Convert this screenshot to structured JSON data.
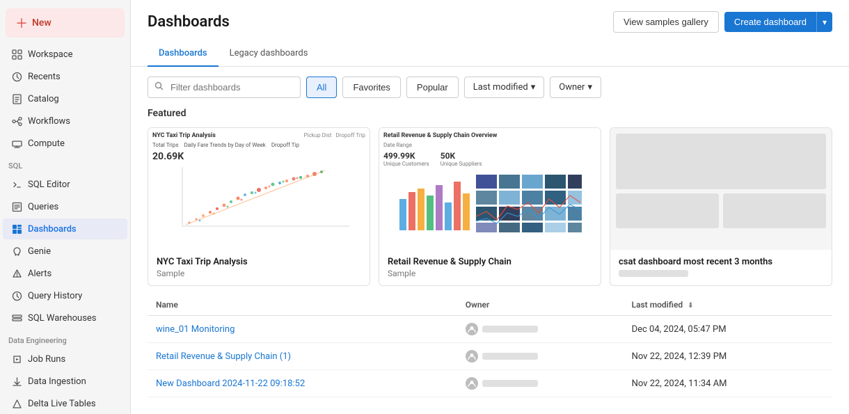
{
  "sidebar": {
    "new_label": "New",
    "items": [
      {
        "id": "workspace",
        "label": "Workspace",
        "icon": "grid"
      },
      {
        "id": "recents",
        "label": "Recents",
        "icon": "clock"
      },
      {
        "id": "catalog",
        "label": "Catalog",
        "icon": "book"
      },
      {
        "id": "workflows",
        "label": "Workflows",
        "icon": "flow"
      },
      {
        "id": "compute",
        "label": "Compute",
        "icon": "server"
      }
    ],
    "sql_section": "SQL",
    "sql_items": [
      {
        "id": "sql-editor",
        "label": "SQL Editor",
        "icon": "code"
      },
      {
        "id": "queries",
        "label": "Queries",
        "icon": "list"
      },
      {
        "id": "dashboards",
        "label": "Dashboards",
        "icon": "dashboard",
        "active": true
      },
      {
        "id": "genie",
        "label": "Genie",
        "icon": "genie"
      },
      {
        "id": "alerts",
        "label": "Alerts",
        "icon": "bell"
      },
      {
        "id": "query-history",
        "label": "Query History",
        "icon": "history"
      },
      {
        "id": "sql-warehouses",
        "label": "SQL Warehouses",
        "icon": "warehouse"
      }
    ],
    "data_engineering_section": "Data Engineering",
    "de_items": [
      {
        "id": "job-runs",
        "label": "Job Runs",
        "icon": "job"
      },
      {
        "id": "data-ingestion",
        "label": "Data Ingestion",
        "icon": "ingest"
      },
      {
        "id": "delta-live-tables",
        "label": "Delta Live Tables",
        "icon": "delta"
      }
    ]
  },
  "header": {
    "title": "Dashboards",
    "view_samples_label": "View samples gallery",
    "create_dashboard_label": "Create dashboard"
  },
  "tabs": [
    {
      "id": "dashboards",
      "label": "Dashboards",
      "active": true
    },
    {
      "id": "legacy",
      "label": "Legacy dashboards",
      "active": false
    }
  ],
  "filters": {
    "search_placeholder": "Filter dashboards",
    "all_label": "All",
    "favorites_label": "Favorites",
    "popular_label": "Popular",
    "last_modified_label": "Last modified",
    "owner_label": "Owner"
  },
  "featured": {
    "title": "Featured",
    "cards": [
      {
        "id": "nyc-taxi",
        "name": "NYC Taxi Trip Analysis",
        "sub": "Sample",
        "metric": "20.69K"
      },
      {
        "id": "retail-revenue",
        "name": "Retail Revenue & Supply Chain",
        "sub": "Sample",
        "metric1": "499.99K",
        "metric2": "50K"
      },
      {
        "id": "csat",
        "name": "csat dashboard most recent 3 months",
        "sub": ""
      }
    ]
  },
  "table": {
    "columns": [
      {
        "id": "name",
        "label": "Name"
      },
      {
        "id": "owner",
        "label": "Owner"
      },
      {
        "id": "last-modified",
        "label": "Last modified"
      }
    ],
    "rows": [
      {
        "name": "wine_01 Monitoring",
        "owner": "",
        "last_modified": "Dec 04, 2024, 05:47 PM"
      },
      {
        "name": "Retail Revenue & Supply Chain (1)",
        "owner": "",
        "last_modified": "Nov 22, 2024, 12:39 PM"
      },
      {
        "name": "New Dashboard 2024-11-22 09:18:52",
        "owner": "",
        "last_modified": "Nov 22, 2024, 11:34 AM"
      }
    ]
  }
}
